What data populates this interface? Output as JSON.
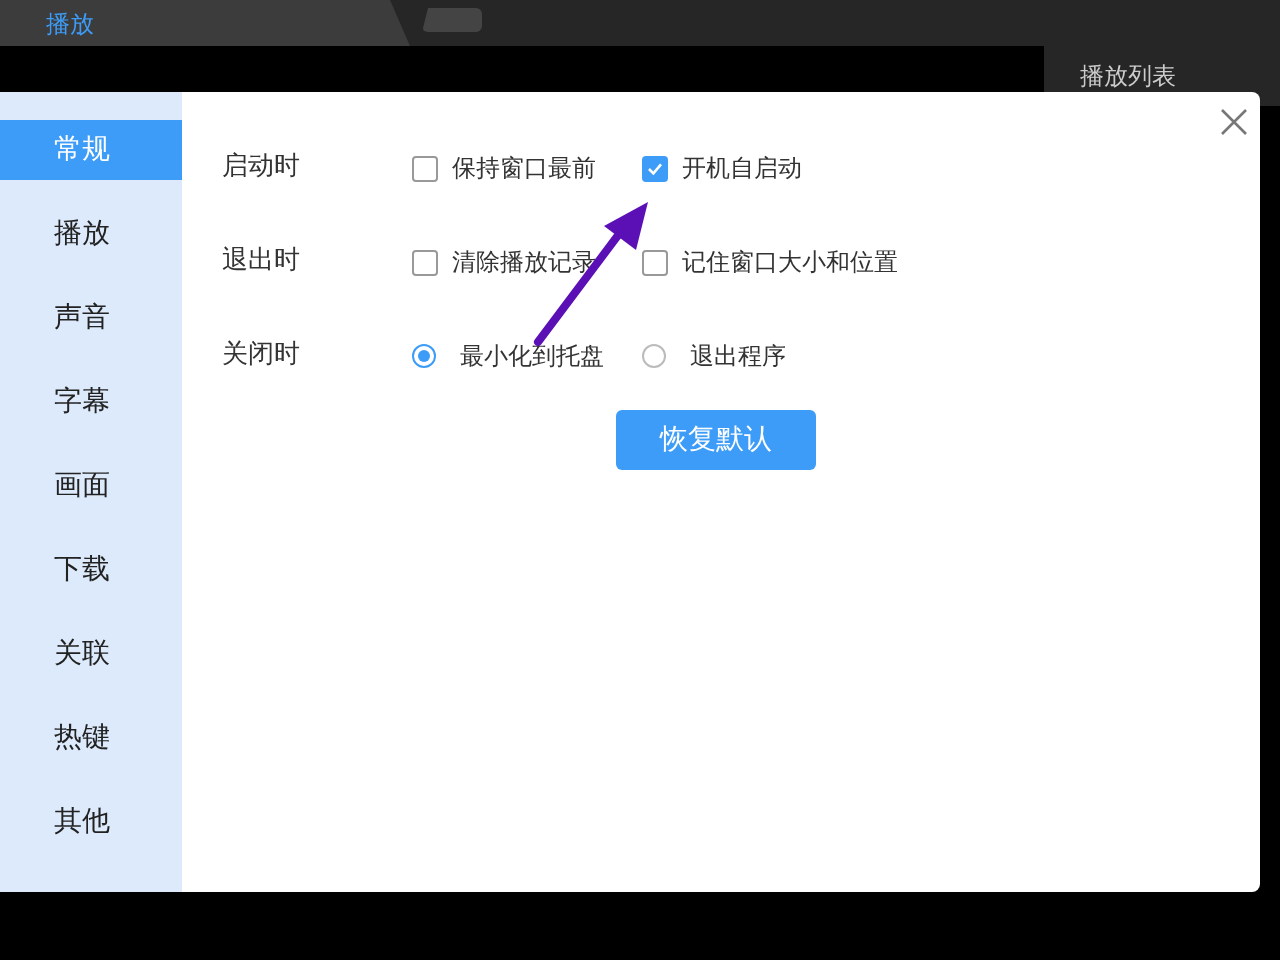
{
  "top_tab": {
    "label": "播放"
  },
  "side_panel": {
    "title": "播放列表"
  },
  "sidebar": {
    "items": [
      {
        "label": "常规",
        "selected": true
      },
      {
        "label": "播放",
        "selected": false
      },
      {
        "label": "声音",
        "selected": false
      },
      {
        "label": "字幕",
        "selected": false
      },
      {
        "label": "画面",
        "selected": false
      },
      {
        "label": "下载",
        "selected": false
      },
      {
        "label": "关联",
        "selected": false
      },
      {
        "label": "热键",
        "selected": false
      },
      {
        "label": "其他",
        "selected": false
      }
    ]
  },
  "settings": [
    {
      "label": "启动时",
      "options": [
        {
          "kind": "checkbox",
          "label": "保持窗口最前",
          "checked": false
        },
        {
          "kind": "checkbox",
          "label": "开机自启动",
          "checked": true
        }
      ]
    },
    {
      "label": "退出时",
      "options": [
        {
          "kind": "checkbox",
          "label": "清除播放记录",
          "checked": false
        },
        {
          "kind": "checkbox",
          "label": "记住窗口大小和位置",
          "checked": false
        }
      ]
    },
    {
      "label": "关闭时",
      "options": [
        {
          "kind": "radio",
          "label": "最小化到托盘",
          "selected": true
        },
        {
          "kind": "radio",
          "label": "退出程序",
          "selected": false
        }
      ]
    }
  ],
  "reset_button": {
    "label": "恢复默认"
  }
}
